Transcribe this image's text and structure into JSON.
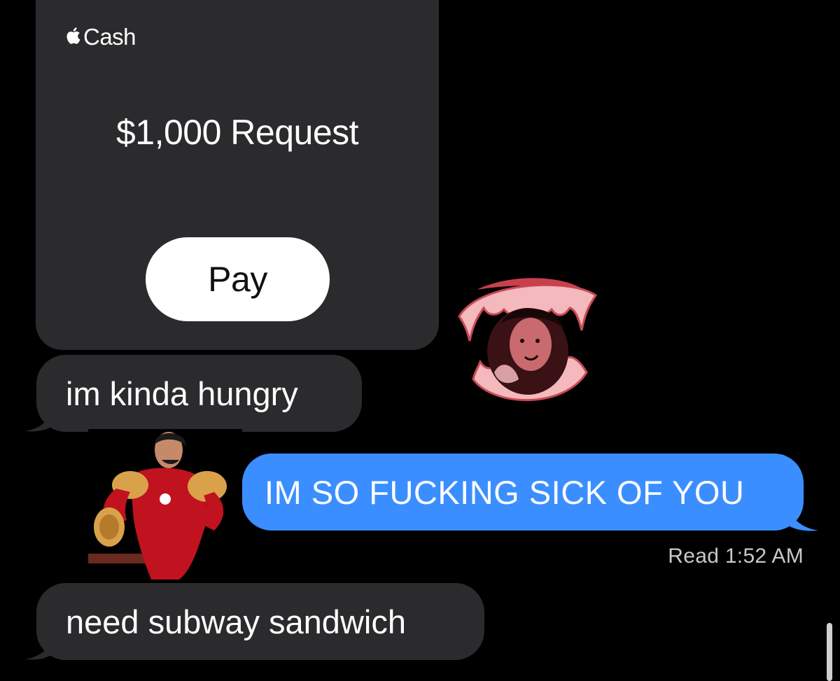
{
  "cash_card": {
    "brand": "Cash",
    "amount_label": "$1,000 Request",
    "pay_label": "Pay"
  },
  "messages": {
    "incoming_1": "im kinda hungry",
    "outgoing_1": "IM SO FUCKING SICK OF YOU",
    "incoming_2": "need subway sandwich"
  },
  "read_receipt": "Read 1:52 AM",
  "colors": {
    "background": "#000000",
    "incoming_bubble": "#2b2b2d",
    "outgoing_bubble": "#3a8eff",
    "pay_button": "#ffffff"
  },
  "stickers": {
    "sticker_1": "iron-man-sticker",
    "sticker_2": "vampire-fangs-sticker"
  }
}
